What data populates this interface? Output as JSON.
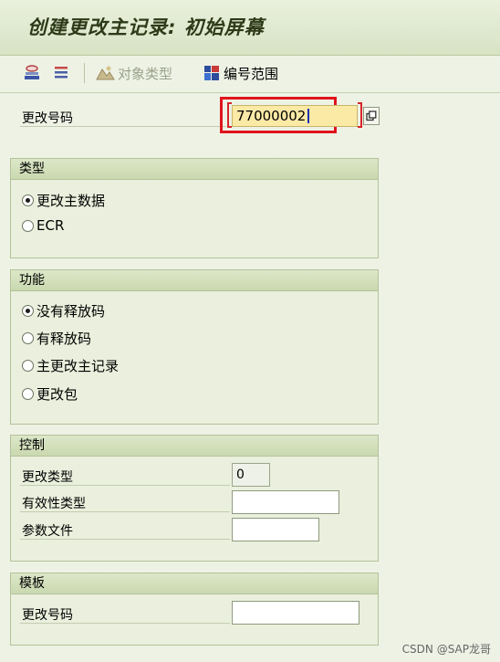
{
  "title": "创建更改主记录: 初始屏幕",
  "toolbar": {
    "object_types_label": "对象类型",
    "number_range_label": "编号范围"
  },
  "change_number": {
    "label": "更改号码",
    "value": "77000002"
  },
  "type_group": {
    "title": "类型",
    "options": [
      {
        "label": "更改主数据",
        "selected": true
      },
      {
        "label": "ECR",
        "selected": false
      }
    ]
  },
  "function_group": {
    "title": "功能",
    "options": [
      {
        "label": "没有释放码",
        "selected": true
      },
      {
        "label": "有释放码",
        "selected": false
      },
      {
        "label": "主更改主记录",
        "selected": false
      },
      {
        "label": "更改包",
        "selected": false
      }
    ]
  },
  "control_group": {
    "title": "控制",
    "change_type": {
      "label": "更改类型",
      "value": "0"
    },
    "validity_type": {
      "label": "有效性类型",
      "value": ""
    },
    "parameter_file": {
      "label": "参数文件",
      "value": ""
    }
  },
  "template_group": {
    "title": "模板",
    "change_number": {
      "label": "更改号码",
      "value": ""
    }
  },
  "watermark": "CSDN @SAP龙哥",
  "colors": {
    "highlight_border": "#e0141c",
    "input_active": "#fbe9a6"
  }
}
